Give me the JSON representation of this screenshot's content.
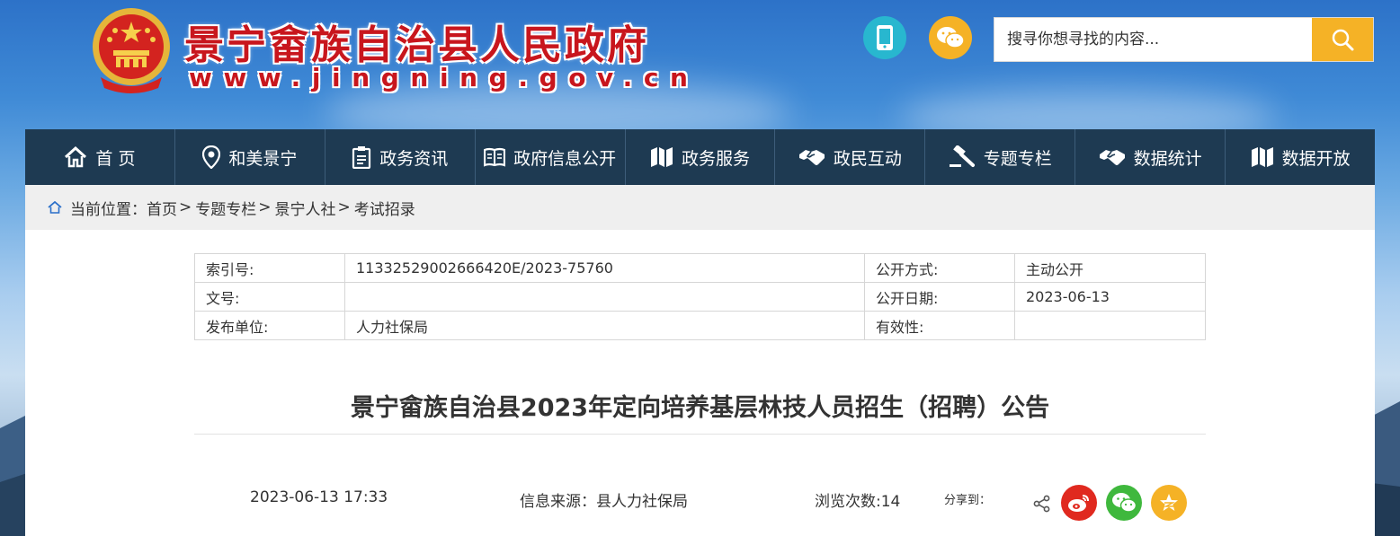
{
  "header": {
    "site_title": "景宁畲族自治县人民政府",
    "site_url": "www.jingning.gov.cn",
    "search": {
      "placeholder": "搜寻你想寻找的内容..."
    },
    "icons": [
      "national-emblem",
      "mobile-icon",
      "wechat-icon",
      "search-icon"
    ],
    "colors": {
      "title_red": "#c8161d",
      "mobile_teal": "#28b7cf",
      "accent_yellow": "#f5b226"
    }
  },
  "nav": {
    "background": "#1e3a52",
    "items": [
      {
        "label": "首 页",
        "icon": "home-icon"
      },
      {
        "label": "和美景宁",
        "icon": "location-pin-icon"
      },
      {
        "label": "政务资讯",
        "icon": "clipboard-icon"
      },
      {
        "label": "政府信息公开",
        "icon": "book-icon"
      },
      {
        "label": "政务服务",
        "icon": "map-icon"
      },
      {
        "label": "政民互动",
        "icon": "handshake-icon"
      },
      {
        "label": "专题专栏",
        "icon": "gavel-icon"
      },
      {
        "label": "数据统计",
        "icon": "handshake-icon"
      },
      {
        "label": "数据开放",
        "icon": "map-icon"
      }
    ]
  },
  "breadcrumb": {
    "prefix": "当前位置：",
    "items": [
      "首页",
      "专题专栏",
      "景宁人社",
      "考试招录"
    ],
    "separator": ">"
  },
  "meta_table": {
    "rows": [
      {
        "k1": "索引号:",
        "v1": "11332529002666420E/2023-75760",
        "k2": "公开方式:",
        "v2": "主动公开"
      },
      {
        "k1": "文号:",
        "v1": "",
        "k2": "公开日期:",
        "v2": "2023-06-13"
      },
      {
        "k1": "发布单位:",
        "v1": "人力社保局",
        "k2": "有效性:",
        "v2": ""
      }
    ]
  },
  "article": {
    "title": "景宁畲族自治县2023年定向培养基层林技人员招生（招聘）公告",
    "datetime": "2023-06-13 17:33",
    "source": "信息来源：县人力社保局",
    "views": "浏览次数:14",
    "share_label": "分享到：",
    "share_icons": [
      "share-icon",
      "weibo-icon",
      "wechat-icon",
      "qzone-star-icon"
    ]
  }
}
